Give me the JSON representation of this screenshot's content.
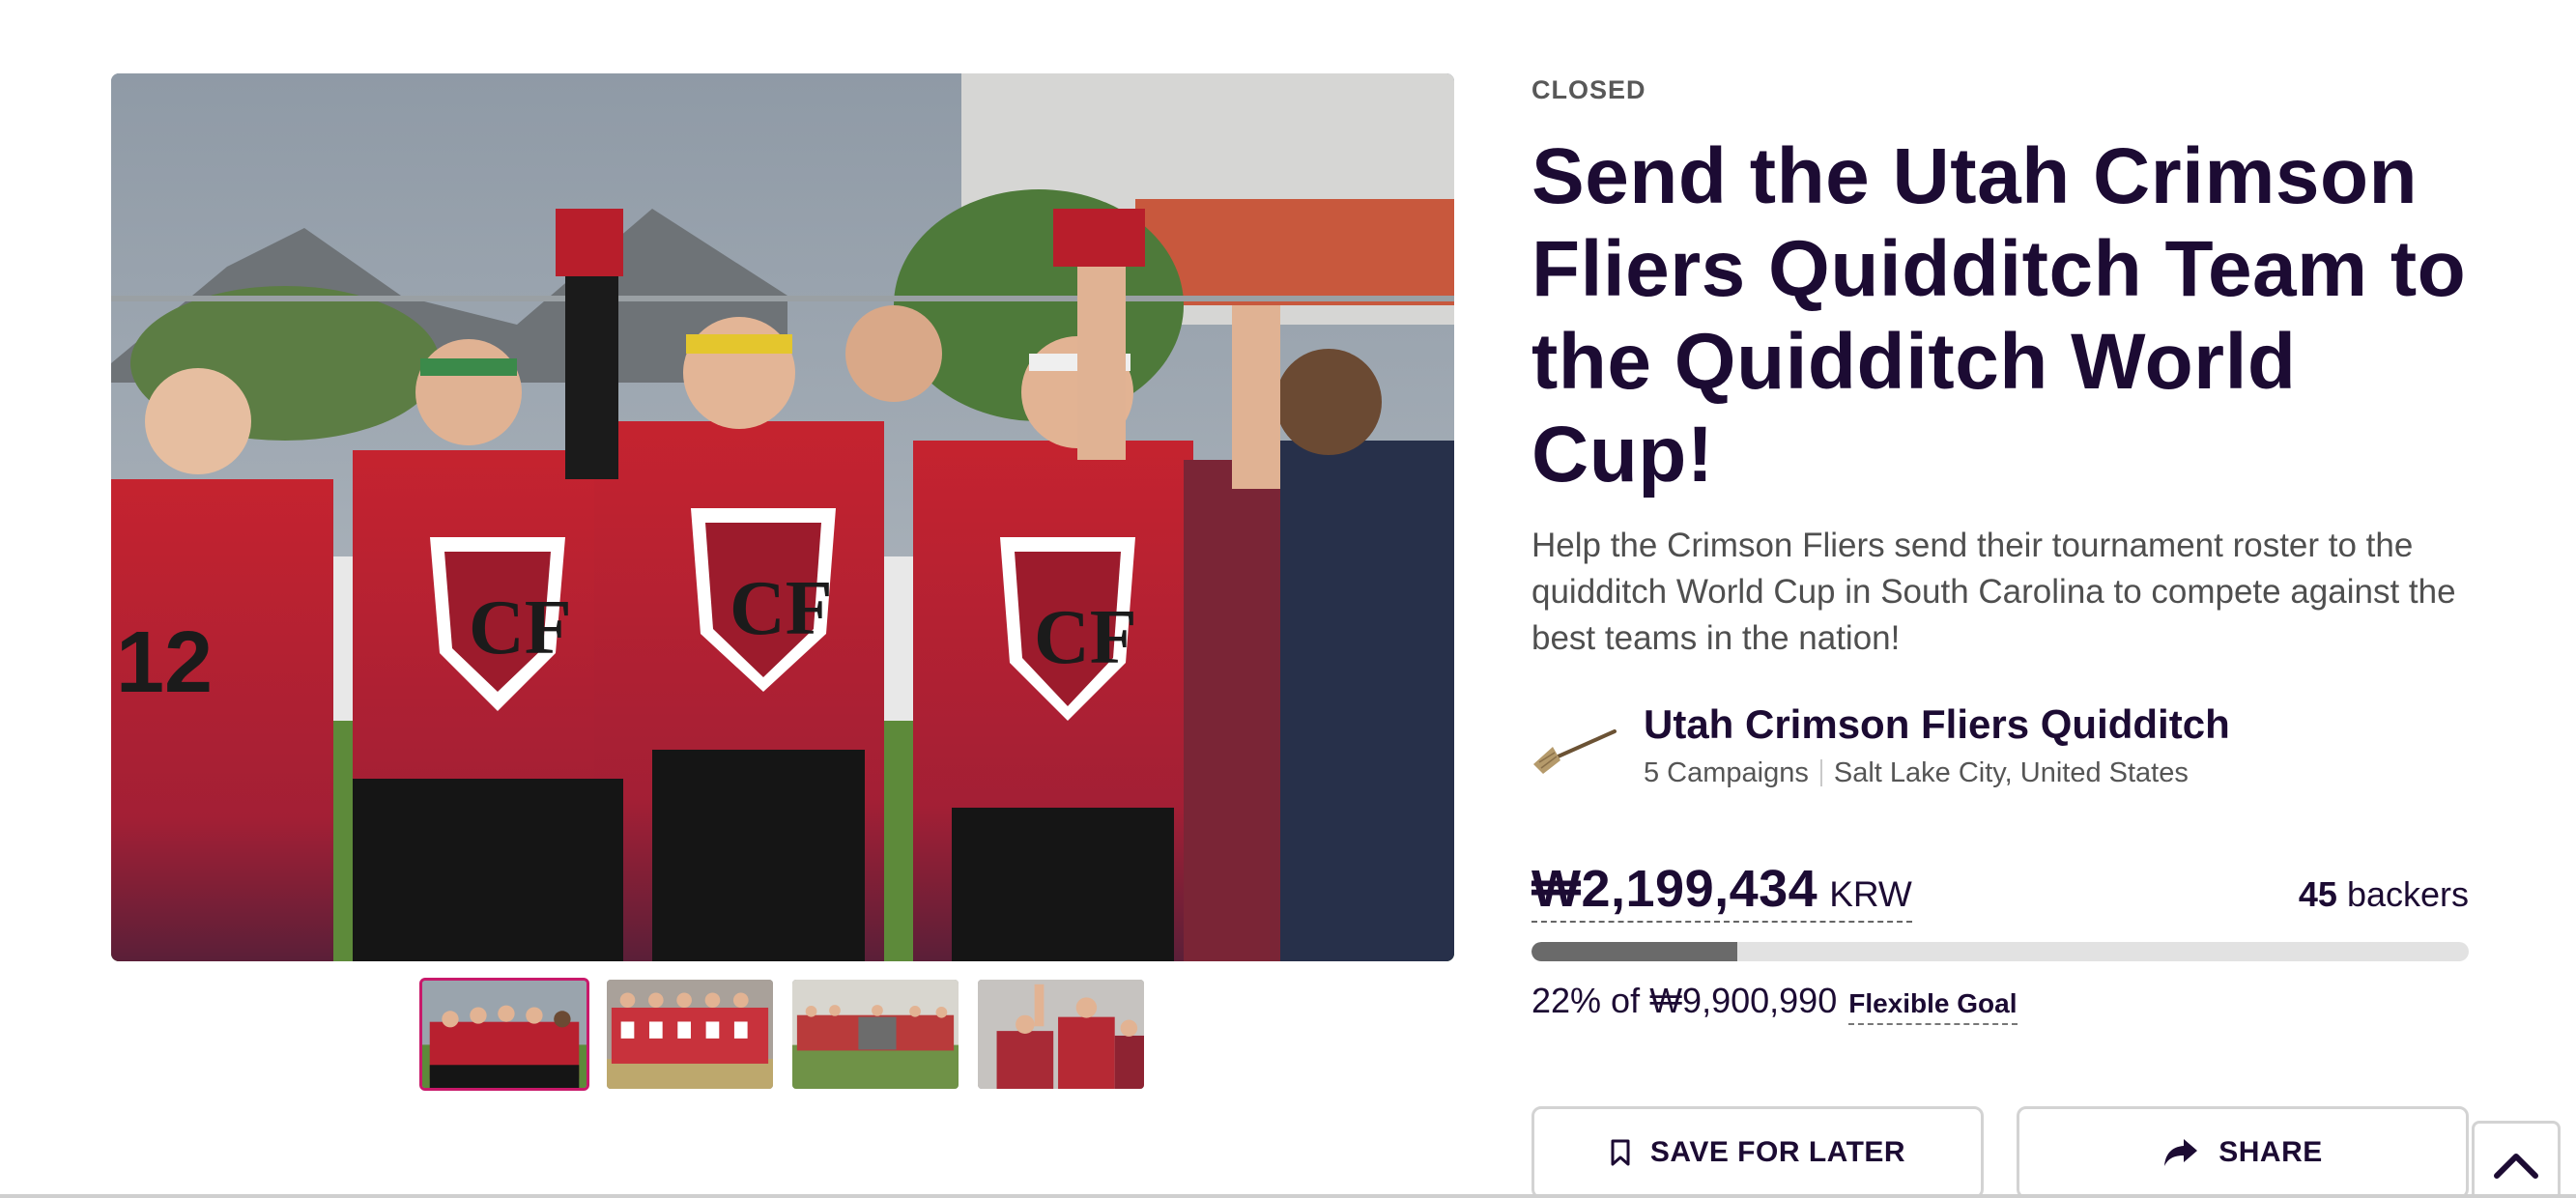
{
  "campaign": {
    "status": "CLOSED",
    "title": "Send the Utah Crimson Fliers Quidditch Team to the Quidditch World Cup!",
    "subtitle": "Help the Crimson Fliers send their tournament roster to the quidditch World Cup in South Carolina to compete against the best teams in the nation!"
  },
  "owner": {
    "avatar_icon": "broom-icon",
    "name": "Utah Crimson Fliers Quidditch",
    "campaigns": "5 Campaigns",
    "location": "Salt Lake City, United States"
  },
  "funding": {
    "amount": "₩2,199,434",
    "currency": "KRW",
    "backers_count": "45",
    "backers_label": "backers",
    "progress_percent": 22,
    "goal_text": "22% of ₩9,900,990",
    "goal_type": "Flexible Goal"
  },
  "actions": {
    "save_label": "SAVE FOR LATER",
    "save_icon": "bookmark-icon",
    "share_label": "SHARE",
    "share_icon": "share-arrow-icon"
  },
  "gallery": {
    "main_image": "team-celebration-photo",
    "thumbnails": [
      "thumb-team-celebration",
      "thumb-team-lineup",
      "thumb-team-field",
      "thumb-team-cheer"
    ],
    "active_index": 0
  },
  "scroll_top_icon": "chevron-up-icon",
  "colors": {
    "title": "#1c0b33",
    "accent_active_thumb": "#c8196a",
    "progress_fill": "#6a6a6a",
    "progress_track": "#e2e2e2"
  }
}
